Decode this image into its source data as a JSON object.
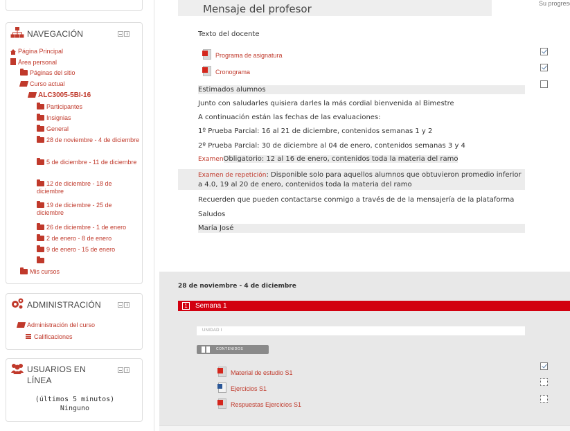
{
  "sidebar": {
    "navigation": {
      "title": "NAVEGACIÓN",
      "items": [
        {
          "label": "Página Principal"
        },
        {
          "label": "Área personal"
        },
        {
          "label": "Páginas del sitio"
        },
        {
          "label": "Curso actual"
        },
        {
          "label": "ALC3005-5BI-16"
        },
        {
          "label": "Participantes"
        },
        {
          "label": "Insignias"
        },
        {
          "label": "General"
        },
        {
          "label": "28 de noviembre - 4 de diciembre"
        },
        {
          "label": "5 de diciembre - 11 de diciembre"
        },
        {
          "label": "12 de diciembre - 18 de diciembre"
        },
        {
          "label": "19 de diciembre - 25 de diciembre"
        },
        {
          "label": "26 de diciembre - 1 de enero"
        },
        {
          "label": "2 de enero - 8 de enero"
        },
        {
          "label": "9 de enero - 15 de enero"
        },
        {
          "label": ""
        },
        {
          "label": "Mis cursos"
        }
      ]
    },
    "administration": {
      "title": "ADMINISTRACIÓN",
      "items": [
        {
          "label": "Administración del curso"
        },
        {
          "label": "Calificaciones"
        }
      ]
    },
    "online_users": {
      "title": "USUARIOS EN LÍNEA",
      "subtitle": "(últimos 5 minutos)",
      "value": "Ninguno"
    }
  },
  "main": {
    "progress_note": "Su progreso",
    "professor_section_title": "Mensaje del profesor",
    "teacher_text_label": "Texto del docente",
    "resources": [
      {
        "label": "Programa de asignatura",
        "checked": true
      },
      {
        "label": "Cronograma",
        "checked": true
      }
    ],
    "message": {
      "greeting": "Estimados alumnos",
      "line1": "Junto con saludarles quisiera darles la más cordial bienvenida al Bimestre",
      "line2": "A continuación están las fechas de las evaluaciones:",
      "line3": "1º Prueba Parcial: 16 al 21 de diciembre, contenidos semanas 1 y 2",
      "line4": "2º Prueba Parcial: 30 de diciembre al 04 de enero, contenidos semanas 3 y 4",
      "exam_label": "Examen",
      "exam_text": "Obligatorio: 12 al 16 de enero, contenidos toda la materia del ramo",
      "repeat_label": "Examen de repetición",
      "repeat_text_a": ": Disponible solo para aquellos alumnos que obtuvieron promedio inferior",
      "repeat_text_b": "a 4.0, 19 al 20 de enero, contenidos toda la materia del ramo",
      "line5": "Recuerden que pueden contactarse conmigo a través de de la mensajería de la plataforma",
      "closing": "Saludos",
      "signature": "María José"
    },
    "week_section": {
      "date_title": "28 de noviembre - 4 de diciembre",
      "week_number": "1",
      "week_label": "Semana 1",
      "unit_label": "UNIDAD I",
      "contents_label": "CONTENIDOS",
      "resources": [
        {
          "label": "Material de estudio S1",
          "checked": true,
          "icon": "pdf-icon"
        },
        {
          "label": "Ejercicios S1",
          "checked": false,
          "icon": "word-icon"
        },
        {
          "label": "Respuestas Ejercicios S1",
          "checked": false,
          "icon": "pdf-icon"
        }
      ]
    }
  },
  "colors": {
    "accent": "#c0392b",
    "week_bar": "#d2000f",
    "section_bg": "#e8e8e8"
  }
}
